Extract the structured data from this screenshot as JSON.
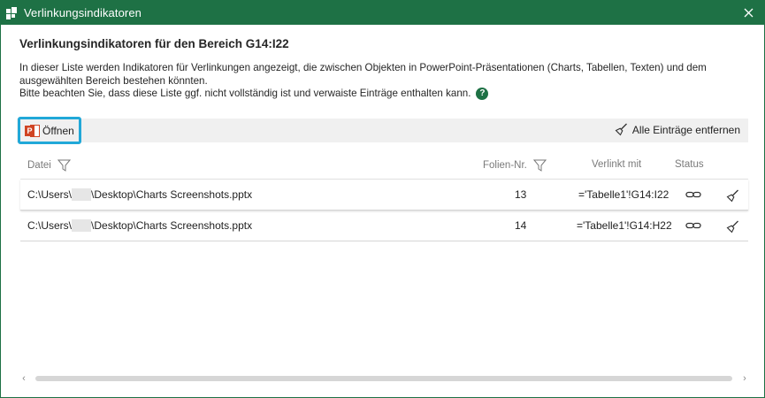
{
  "window": {
    "title": "Verlinkungsindikatoren"
  },
  "heading": "Verlinkungsindikatoren für den Bereich G14:I22",
  "description": {
    "line1": "In dieser Liste werden Indikatoren für Verlinkungen angezeigt, die zwischen Objekten in PowerPoint-Präsentationen (Charts, Tabellen, Texten) und dem",
    "line2": "ausgewählten Bereich bestehen könnten.",
    "line3": "Bitte beachten Sie, dass diese Liste ggf. nicht vollständig ist und verwaiste Einträge enthalten kann."
  },
  "toolbar": {
    "open_label": "Öffnen",
    "clear_all_label": "Alle Einträge entfernen"
  },
  "table": {
    "columns": {
      "file": "Datei",
      "slide": "Folien-Nr.",
      "linked": "Verlinkt mit",
      "status": "Status"
    },
    "rows": [
      {
        "path_prefix": "C:\\Users\\",
        "path_suffix": "\\Desktop\\Charts Screenshots.pptx",
        "slide": "13",
        "linked": "='Tabelle1'!G14:I22"
      },
      {
        "path_prefix": "C:\\Users\\",
        "path_suffix": "\\Desktop\\Charts Screenshots.pptx",
        "slide": "14",
        "linked": "='Tabelle1'!G14:H22"
      }
    ]
  },
  "colors": {
    "accent": "#1e7145",
    "highlight": "#21a8d8",
    "powerpoint": "#d04423"
  }
}
